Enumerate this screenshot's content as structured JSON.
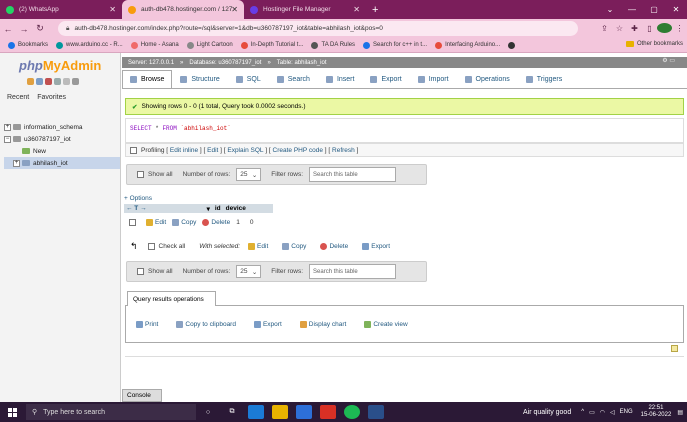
{
  "browser": {
    "tabs": [
      {
        "label": "(2) WhatsApp",
        "active": false,
        "color": "#25d366"
      },
      {
        "label": "auth-db478.hostinger.com / 127",
        "active": true,
        "color": "#f89c0e"
      },
      {
        "label": "Hostinger File Manager",
        "active": false,
        "color": "#673de6"
      }
    ],
    "new_tab": "+",
    "url": "auth-db478.hostinger.com/index.php?route=/sql&server=1&db=u360787197_iot&table=abhilash_iot&pos=0",
    "bookmarks": [
      {
        "label": "Bookmarks",
        "color": "#1a73e8"
      },
      {
        "label": "www.arduino.cc - R...",
        "color": "#00979d"
      },
      {
        "label": "Home - Asana",
        "color": "#f06a6a"
      },
      {
        "label": "Light Cartoon",
        "color": "#888888"
      },
      {
        "label": "In-Depth Tutorial t...",
        "color": "#e74c3c"
      },
      {
        "label": "TA DA Rules",
        "color": "#555555"
      },
      {
        "label": "Search for c++ in t...",
        "color": "#1a73e8"
      },
      {
        "label": "Interfacing Arduino...",
        "color": "#e74c3c"
      }
    ],
    "other_bookmarks": "Other bookmarks"
  },
  "sidebar": {
    "logo_php": "php",
    "logo_myadmin": "MyAdmin",
    "tabs": [
      "Recent",
      "Favorites"
    ],
    "tree": [
      {
        "label": "information_schema",
        "sign": "+"
      },
      {
        "label": "u360787197_iot",
        "sign": "−"
      },
      {
        "label": "New",
        "sign": ""
      },
      {
        "label": "abhilash_iot",
        "sign": "+"
      }
    ]
  },
  "breadcrumb": {
    "server": "Server: 127.0.0.1",
    "database": "Database: u360787197_iot",
    "table": "Table: abhilash_iot"
  },
  "main_tabs": [
    {
      "label": "Browse",
      "active": true
    },
    {
      "label": "Structure",
      "active": false
    },
    {
      "label": "SQL",
      "active": false
    },
    {
      "label": "Search",
      "active": false
    },
    {
      "label": "Insert",
      "active": false
    },
    {
      "label": "Export",
      "active": false
    },
    {
      "label": "Import",
      "active": false
    },
    {
      "label": "Operations",
      "active": false
    },
    {
      "label": "Triggers",
      "active": false
    }
  ],
  "result": {
    "message": "Showing rows 0 - 0 (1 total, Query took 0.0002 seconds.)",
    "sql_select": "SELECT",
    "sql_star": "*",
    "sql_from": "FROM",
    "sql_table": "`abhilash_iot`"
  },
  "profiling": {
    "label": "Profiling",
    "links": [
      "Edit inline",
      "Edit",
      "Explain SQL",
      "Create PHP code",
      "Refresh"
    ]
  },
  "nav_controls": {
    "show_all": "Show all",
    "rows_label": "Number of rows:",
    "rows_value": "25",
    "filter_label": "Filter rows:",
    "filter_placeholder": "Search this table"
  },
  "table": {
    "options": "+ Options",
    "columns": [
      "id",
      "device"
    ],
    "rows": [
      {
        "edit": "Edit",
        "copy": "Copy",
        "delete": "Delete",
        "id": "1",
        "device": "0"
      }
    ]
  },
  "with_selected": {
    "check_all": "Check all",
    "label": "With selected:",
    "edit": "Edit",
    "copy": "Copy",
    "delete": "Delete",
    "export": "Export"
  },
  "query_ops": {
    "title": "Query results operations",
    "actions": [
      "Print",
      "Copy to clipboard",
      "Export",
      "Display chart",
      "Create view"
    ]
  },
  "console": "Console",
  "taskbar": {
    "search_placeholder": "Type here to search",
    "air_quality": "Air quality good",
    "lang": "ENG",
    "time": "22:51",
    "date": "15-06-2022"
  }
}
